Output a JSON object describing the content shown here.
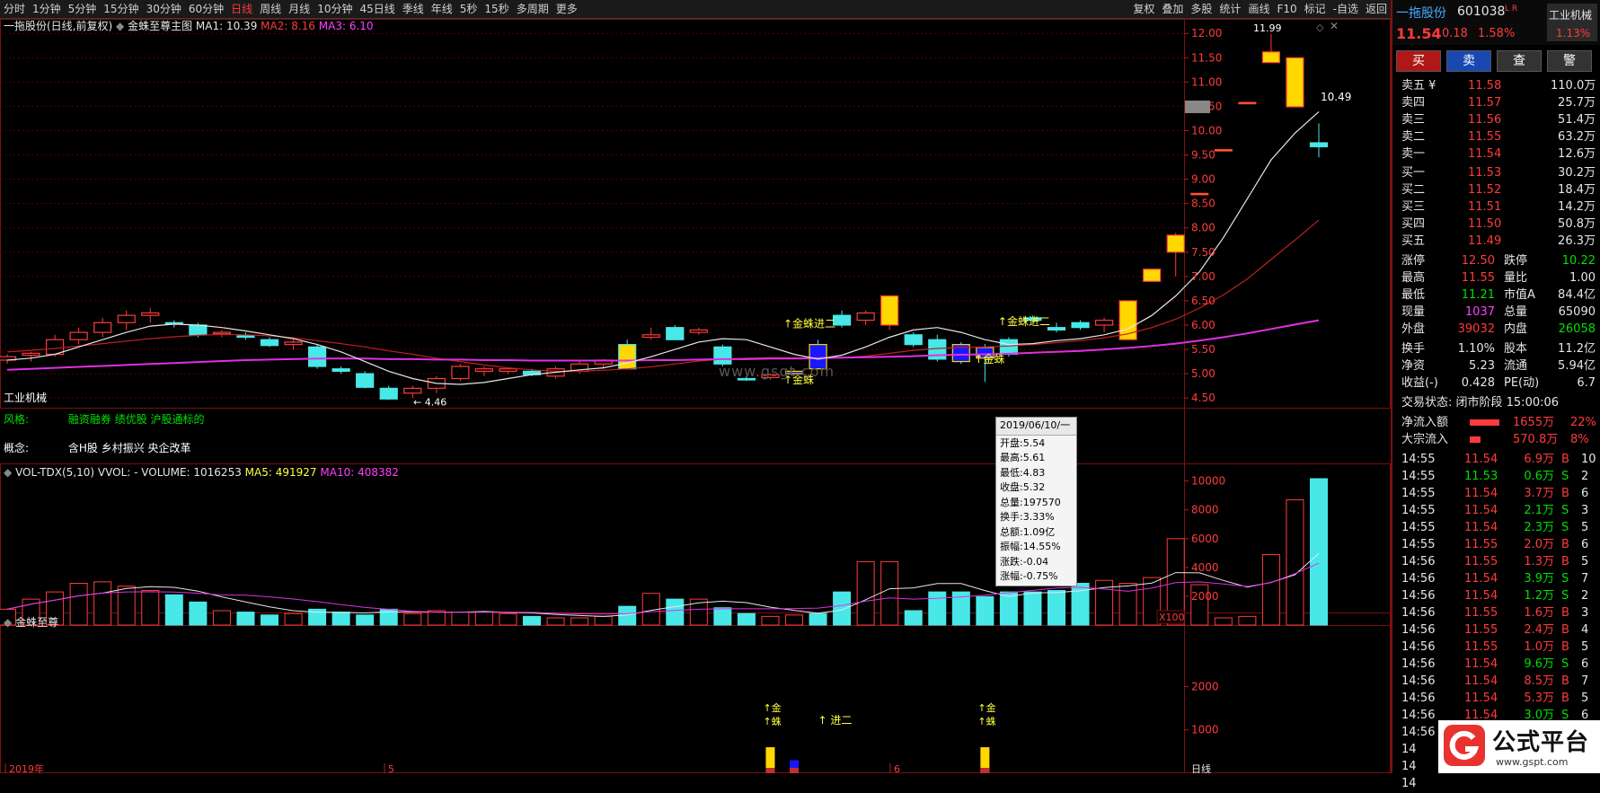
{
  "toolbar": {
    "periods": [
      "分时",
      "1分钟",
      "5分钟",
      "15分钟",
      "30分钟",
      "60分钟",
      "日线",
      "周线",
      "月线",
      "10分钟",
      "45日线",
      "季线",
      "年线",
      "5秒",
      "15秒",
      "多周期",
      "更多"
    ],
    "active": "日线",
    "tools": [
      "复权",
      "叠加",
      "多股",
      "统计",
      "画线",
      "F10",
      "标记",
      "-自选",
      "返回"
    ]
  },
  "main": {
    "title": "一拖股份(日线,前复权)",
    "indicator": "金蛛至尊主图",
    "ma1": "MA1: 10.39",
    "ma2": "MA2: 8.16",
    "ma3": "MA3: 6.10",
    "price_ticks": [
      "12.00",
      "11.50",
      "11.00",
      "10.50",
      "10.00",
      "9.50",
      "9.00",
      "8.50",
      "8.00",
      "7.50",
      "7.00",
      "6.50",
      "6.00",
      "5.50",
      "5.00",
      "4.50"
    ],
    "current_price_label": "10.49",
    "high_label": "11.99",
    "low_label": "4.46",
    "industry": "工业机械",
    "style_label": "风格:",
    "style_value": "融资融券 绩优股 沪股通标的",
    "concept_label": "概念:",
    "concept_value": "含H股 乡村振兴 央企改革",
    "signals": [
      "金蛛进二",
      "金蛛",
      "金蛛进二",
      "金蛛"
    ],
    "watermark": "www.gsgt.com"
  },
  "tooltip": {
    "date": "2019/06/10/一",
    "open": "开盘:5.54",
    "high": "最高:5.61",
    "low": "最低:4.83",
    "close": "收盘:5.32",
    "volume": "总量:197570",
    "turnover": "换手:3.33%",
    "amount": "总额:1.09亿",
    "amplitude": "振幅:14.55%",
    "change": "涨跌:-0.04",
    "change_pct": "涨幅:-0.75%"
  },
  "volume": {
    "title": "VOL-TDX(5,10)",
    "vvol": "VVOL: -",
    "volume": "VOLUME: 1016253",
    "ma5": "MA5: 491927",
    "ma10": "MA10: 408382",
    "ticks": [
      "10000",
      "8000",
      "6000",
      "4000",
      "2000"
    ],
    "unit": "X100"
  },
  "sub": {
    "title": "金蛛至尊",
    "ticks": [
      "2000",
      "1000"
    ],
    "sig_a": "金",
    "sig_b": "蛛",
    "jin2": "进二"
  },
  "xaxis": {
    "labels": [
      "2019年",
      "5",
      "6"
    ],
    "period": "日线"
  },
  "quote": {
    "name": "一拖股份",
    "code": "601038",
    "flags": "L R",
    "industry": "工业机械",
    "industry_pct": "1.13%",
    "price": "11.54",
    "change": "0.18",
    "pct": "1.58%",
    "buttons": [
      "买",
      "卖",
      "查",
      "警"
    ],
    "asks": [
      {
        "label": "卖五",
        "price": "11.58",
        "vol": "110.0万"
      },
      {
        "label": "卖四",
        "price": "11.57",
        "vol": "25.7万"
      },
      {
        "label": "卖三",
        "price": "11.56",
        "vol": "51.4万"
      },
      {
        "label": "卖二",
        "price": "11.55",
        "vol": "63.2万"
      },
      {
        "label": "卖一",
        "price": "11.54",
        "vol": "12.6万"
      }
    ],
    "ask_symbol": "¥",
    "bids": [
      {
        "label": "买一",
        "price": "11.53",
        "vol": "30.2万"
      },
      {
        "label": "买二",
        "price": "11.52",
        "vol": "18.4万"
      },
      {
        "label": "买三",
        "price": "11.51",
        "vol": "14.2万"
      },
      {
        "label": "买四",
        "price": "11.50",
        "vol": "50.8万"
      },
      {
        "label": "买五",
        "price": "11.49",
        "vol": "26.3万"
      }
    ],
    "stats": [
      {
        "l1": "涨停",
        "v1": "12.50",
        "c1": "red",
        "l2": "跌停",
        "v2": "10.22",
        "c2": "green"
      },
      {
        "l1": "最高",
        "v1": "11.55",
        "c1": "red",
        "l2": "量比",
        "v2": "1.00",
        "c2": "white"
      },
      {
        "l1": "最低",
        "v1": "11.21",
        "c1": "green",
        "l2": "市值A",
        "v2": "84.4亿",
        "c2": "white"
      },
      {
        "l1": "现量",
        "v1": "1037",
        "c1": "mag",
        "l2": "总量",
        "v2": "65090",
        "c2": "white"
      },
      {
        "l1": "外盘",
        "v1": "39032",
        "c1": "red",
        "l2": "内盘",
        "v2": "26058",
        "c2": "green"
      }
    ],
    "stats2": [
      {
        "l1": "换手",
        "v1": "1.10%",
        "l2": "股本",
        "v2": "11.2亿"
      },
      {
        "l1": "净资",
        "v1": "5.23",
        "l2": "流通",
        "v2": "5.94亿"
      },
      {
        "l1": "收益(-)",
        "v1": "0.428",
        "l2": "PE(动)",
        "v2": "6.7"
      }
    ],
    "trade_status": "交易状态: 闭市阶段 15:00:06",
    "netflow_label": "净流入额",
    "netflow_value": "1655万",
    "netflow_pct": "22%",
    "netflow_ratio": 0.78,
    "block_label": "大宗流入",
    "block_value": "570.8万",
    "block_pct": "8%",
    "block_ratio": 0.28
  },
  "ticks_list": [
    [
      "14:55",
      "11.54",
      "6.9万",
      "B",
      "10"
    ],
    [
      "14:55",
      "11.53",
      "0.6万",
      "S",
      "2"
    ],
    [
      "14:55",
      "11.54",
      "3.7万",
      "B",
      "6"
    ],
    [
      "14:55",
      "11.54",
      "2.1万",
      "S",
      "3"
    ],
    [
      "14:55",
      "11.54",
      "2.3万",
      "S",
      "5"
    ],
    [
      "14:55",
      "11.55",
      "2.0万",
      "B",
      "6"
    ],
    [
      "14:56",
      "11.55",
      "1.3万",
      "B",
      "5"
    ],
    [
      "14:56",
      "11.54",
      "3.9万",
      "S",
      "7"
    ],
    [
      "14:56",
      "11.54",
      "1.2万",
      "S",
      "2"
    ],
    [
      "14:56",
      "11.55",
      "1.6万",
      "B",
      "3"
    ],
    [
      "14:56",
      "11.55",
      "2.4万",
      "B",
      "4"
    ],
    [
      "14:56",
      "11.55",
      "1.0万",
      "B",
      "5"
    ],
    [
      "14:56",
      "11.54",
      "9.6万",
      "S",
      "6"
    ],
    [
      "14:56",
      "11.54",
      "8.5万",
      "B",
      "7"
    ],
    [
      "14:56",
      "11.54",
      "5.3万",
      "B",
      "5"
    ],
    [
      "14:56",
      "11.54",
      "3.0万",
      "S",
      "6"
    ],
    [
      "14:56",
      "11.54",
      "0.1万",
      "S",
      "5"
    ],
    [
      "14",
      "",
      "",
      "",
      ""
    ],
    [
      "14",
      "",
      "",
      "",
      ""
    ],
    [
      "14",
      "",
      "",
      "",
      ""
    ]
  ],
  "brand": {
    "name": "公式平台",
    "url": "www.gspt.com"
  },
  "chart_data": {
    "type": "candlestick",
    "price_range": [
      4.3,
      12.3
    ],
    "candles": [
      [
        5.28,
        5.4,
        5.2,
        5.35
      ],
      [
        5.38,
        5.45,
        5.25,
        5.42
      ],
      [
        5.4,
        5.8,
        5.35,
        5.7
      ],
      [
        5.7,
        5.95,
        5.6,
        5.85
      ],
      [
        5.85,
        6.15,
        5.75,
        6.05
      ],
      [
        6.05,
        6.3,
        5.9,
        6.2
      ],
      [
        6.2,
        6.35,
        6.05,
        6.25
      ],
      [
        6.05,
        6.1,
        5.95,
        6.02
      ],
      [
        6.0,
        6.05,
        5.75,
        5.8
      ],
      [
        5.82,
        5.9,
        5.75,
        5.85
      ],
      [
        5.78,
        5.85,
        5.7,
        5.75
      ],
      [
        5.7,
        5.75,
        5.55,
        5.58
      ],
      [
        5.6,
        5.7,
        5.5,
        5.65
      ],
      [
        5.55,
        5.6,
        5.1,
        5.15
      ],
      [
        5.1,
        5.15,
        5.0,
        5.05
      ],
      [
        5.0,
        5.05,
        4.7,
        4.72
      ],
      [
        4.7,
        4.75,
        4.46,
        4.48
      ],
      [
        4.6,
        4.75,
        4.5,
        4.7
      ],
      [
        4.7,
        4.95,
        4.6,
        4.9
      ],
      [
        4.9,
        5.2,
        4.85,
        5.15
      ],
      [
        5.05,
        5.15,
        4.95,
        5.1
      ],
      [
        5.05,
        5.12,
        5.0,
        5.1
      ],
      [
        5.05,
        5.1,
        4.95,
        4.98
      ],
      [
        4.95,
        5.15,
        4.9,
        5.1
      ],
      [
        5.05,
        5.25,
        5.0,
        5.2
      ],
      [
        5.2,
        5.3,
        5.1,
        5.28
      ],
      [
        5.6,
        5.7,
        5.1,
        5.1
      ],
      [
        5.75,
        5.95,
        5.7,
        5.8
      ],
      [
        5.95,
        6.0,
        5.7,
        5.7
      ],
      [
        5.85,
        5.95,
        5.8,
        5.9
      ],
      [
        5.55,
        5.6,
        5.15,
        5.2
      ],
      [
        4.9,
        4.95,
        4.85,
        4.88
      ],
      [
        4.92,
        5.0,
        4.88,
        4.98
      ],
      [
        5.0,
        5.1,
        4.95,
        5.05
      ],
      [
        5.6,
        5.7,
        5.1,
        5.1
      ],
      [
        6.2,
        6.3,
        5.95,
        6.0
      ],
      [
        6.1,
        6.3,
        6.0,
        6.25
      ],
      [
        6.0,
        6.6,
        5.9,
        6.6
      ],
      [
        5.8,
        5.85,
        5.55,
        5.6
      ],
      [
        5.7,
        5.8,
        5.25,
        5.3
      ],
      [
        5.6,
        5.65,
        5.2,
        5.25
      ],
      [
        5.54,
        5.61,
        4.83,
        5.32
      ],
      [
        5.7,
        5.75,
        5.35,
        5.4
      ],
      [
        6.15,
        6.2,
        6.05,
        6.1
      ],
      [
        5.95,
        6.05,
        5.85,
        5.9
      ],
      [
        6.05,
        6.1,
        5.9,
        5.95
      ],
      [
        6.0,
        6.15,
        5.85,
        6.1
      ],
      [
        5.7,
        6.5,
        5.7,
        6.5
      ],
      [
        6.9,
        7.15,
        6.9,
        7.15
      ],
      [
        7.5,
        7.9,
        7.0,
        7.85
      ],
      [
        8.7,
        8.72,
        8.7,
        8.71
      ],
      [
        9.6,
        9.62,
        9.59,
        9.61
      ],
      [
        10.57,
        10.59,
        10.56,
        10.58
      ],
      [
        11.4,
        11.99,
        11.4,
        11.62
      ],
      [
        10.49,
        11.5,
        10.49,
        11.5
      ],
      [
        9.75,
        10.15,
        9.45,
        9.67
      ]
    ],
    "volumes": [
      1100,
      1800,
      2300,
      2900,
      3000,
      2700,
      2400,
      2100,
      1600,
      1000,
      900,
      700,
      800,
      1100,
      900,
      700,
      1100,
      800,
      1000,
      900,
      900,
      800,
      600,
      500,
      500,
      600,
      1300,
      2200,
      1800,
      1800,
      1200,
      800,
      600,
      700,
      800,
      2300,
      4400,
      4400,
      1000,
      2300,
      2300,
      1975,
      2300,
      2300,
      2400,
      2900,
      3100,
      2900,
      3300,
      6000,
      2800,
      500,
      600,
      4900,
      8700,
      10163
    ],
    "ma_white": [
      5.28,
      5.32,
      5.4,
      5.55,
      5.7,
      5.85,
      5.98,
      6.02,
      6.0,
      5.95,
      5.88,
      5.8,
      5.72,
      5.6,
      5.45,
      5.25,
      5.05,
      4.9,
      4.8,
      4.78,
      4.82,
      4.9,
      4.98,
      5.03,
      5.08,
      5.12,
      5.22,
      5.35,
      5.5,
      5.65,
      5.72,
      5.7,
      5.55,
      5.4,
      5.3,
      5.38,
      5.55,
      5.75,
      5.9,
      5.95,
      5.85,
      5.7,
      5.6,
      5.62,
      5.68,
      5.72,
      5.8,
      5.92,
      6.2,
      6.6,
      7.1,
      7.8,
      8.6,
      9.4,
      9.95,
      10.39
    ],
    "ma_red": [
      5.45,
      5.48,
      5.52,
      5.57,
      5.62,
      5.67,
      5.72,
      5.76,
      5.79,
      5.81,
      5.8,
      5.78,
      5.74,
      5.68,
      5.62,
      5.55,
      5.47,
      5.4,
      5.32,
      5.25,
      5.18,
      5.12,
      5.08,
      5.05,
      5.05,
      5.07,
      5.1,
      5.14,
      5.2,
      5.26,
      5.3,
      5.32,
      5.33,
      5.33,
      5.32,
      5.33,
      5.36,
      5.42,
      5.48,
      5.52,
      5.54,
      5.55,
      5.57,
      5.6,
      5.64,
      5.68,
      5.74,
      5.82,
      5.95,
      6.12,
      6.35,
      6.62,
      6.95,
      7.35,
      7.75,
      8.16
    ],
    "ma_mag": [
      5.08,
      5.1,
      5.12,
      5.14,
      5.16,
      5.18,
      5.2,
      5.22,
      5.24,
      5.26,
      5.28,
      5.29,
      5.3,
      5.31,
      5.31,
      5.31,
      5.3,
      5.3,
      5.29,
      5.29,
      5.28,
      5.28,
      5.27,
      5.27,
      5.27,
      5.27,
      5.27,
      5.28,
      5.28,
      5.29,
      5.3,
      5.3,
      5.31,
      5.31,
      5.32,
      5.33,
      5.34,
      5.35,
      5.36,
      5.38,
      5.39,
      5.4,
      5.41,
      5.43,
      5.45,
      5.47,
      5.5,
      5.53,
      5.57,
      5.62,
      5.68,
      5.75,
      5.83,
      5.92,
      6.01,
      6.1
    ],
    "signal_candles": [
      33,
      34,
      40,
      41
    ],
    "sub_bars": [
      [
        32,
        600
      ],
      [
        33,
        300
      ],
      [
        41,
        600
      ]
    ]
  }
}
